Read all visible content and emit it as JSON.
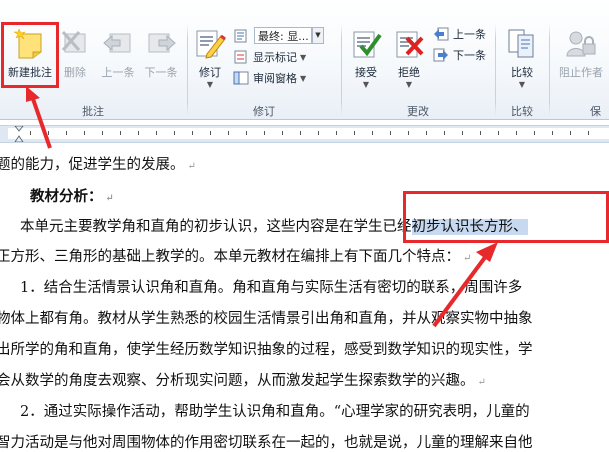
{
  "ribbon": {
    "comments": {
      "group_label": "批注",
      "new_comment": "新建批注",
      "delete": "删除",
      "previous": "上一条",
      "next": "下一条"
    },
    "tracking": {
      "group_label": "修订",
      "track_changes": "修订",
      "display_mode": "最终: 显...",
      "show_markup": "显示标记",
      "reviewing_pane": "审阅窗格"
    },
    "changes": {
      "group_label": "更改",
      "accept": "接受",
      "reject": "拒绝",
      "previous": "上一条",
      "next": "下一条"
    },
    "compare": {
      "group_label": "比较",
      "compare": "比较"
    },
    "protect": {
      "group_label": "保",
      "block_authors": "阻止作者"
    }
  },
  "document": {
    "lines": [
      "题的能力，促进学生的发展。",
      "教材分析：",
      "本单元主要教学角和直角的初步认识，这些内容是在学生已经",
      "初步认识长方形、",
      "正方形、三角形的基础上教学的。本单元教材在编排上有下面几个特点：",
      "1．结合生活情景认识角和直角。角和直角与实际生活有密切的联系，周围许多",
      "物体上都有角。教材从学生熟悉的校园生活情景引出角和直角，并从观察实物中抽象",
      "出所学的角和直角，使学生经历数学知识抽象的过程，感受到数学知识的现实性，学",
      "会从数学的角度去观察、分析现实问题，从而激发起学生探索数学的兴趣。",
      "2．通过实际操作活动，帮助学生认识角和直角。“心理学家的研究表明，儿童的",
      "智力活动是与他对周围物体的作用密切联系在一起的，也就是说，儿童的理解来自他"
    ],
    "paragraph_mark": "↵"
  },
  "colors": {
    "annotation_red": "#e8292b",
    "selection_blue": "#c6d9f1",
    "ribbon_border": "#b9c9db"
  }
}
